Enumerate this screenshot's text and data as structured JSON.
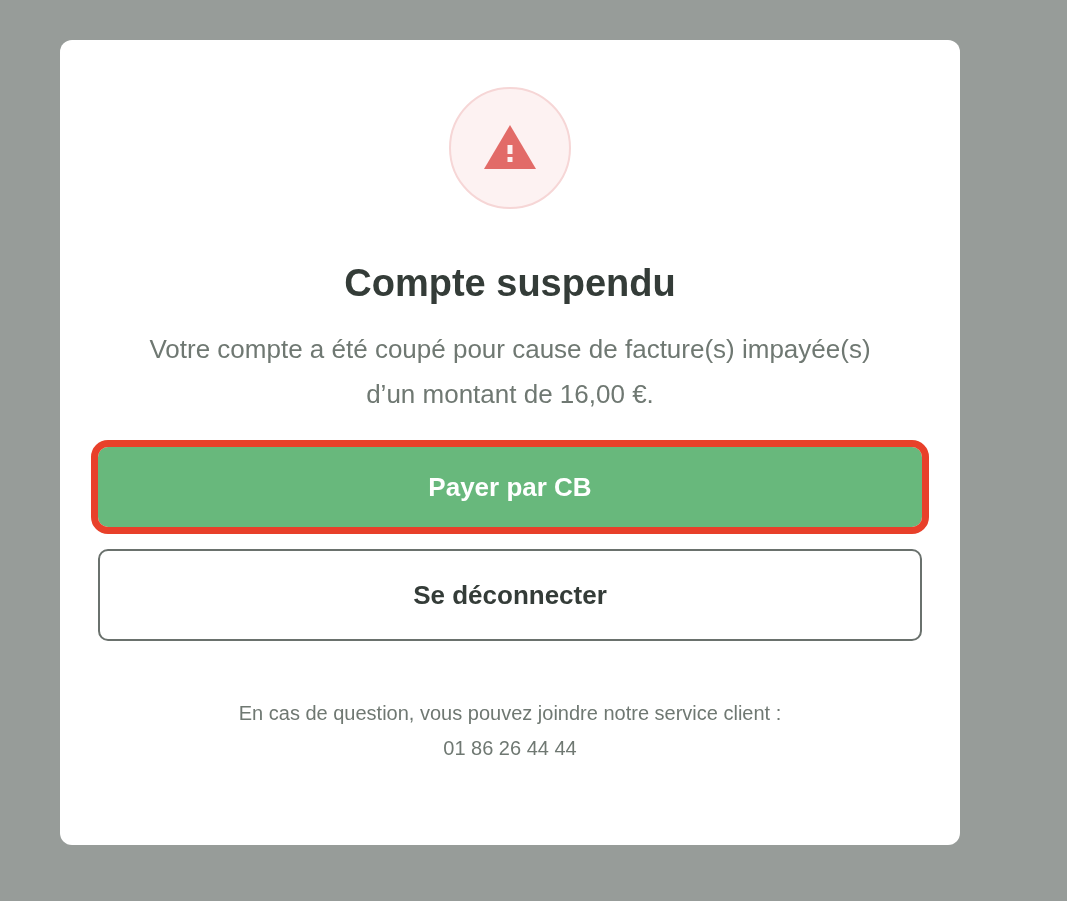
{
  "dialog": {
    "title": "Compte suspendu",
    "message": "Votre compte a été coupé pour cause de facture(s) impayée(s) d’un montant de 16,00 €.",
    "buttons": [
      {
        "label": "Payer par CB",
        "kind": "primary",
        "highlighted": true
      },
      {
        "label": "Se déconnecter",
        "kind": "secondary",
        "highlighted": false
      }
    ],
    "footer": {
      "text": "En cas de question, vous pouvez joindre notre service client :",
      "phone": "01 86 26 44 44"
    }
  }
}
